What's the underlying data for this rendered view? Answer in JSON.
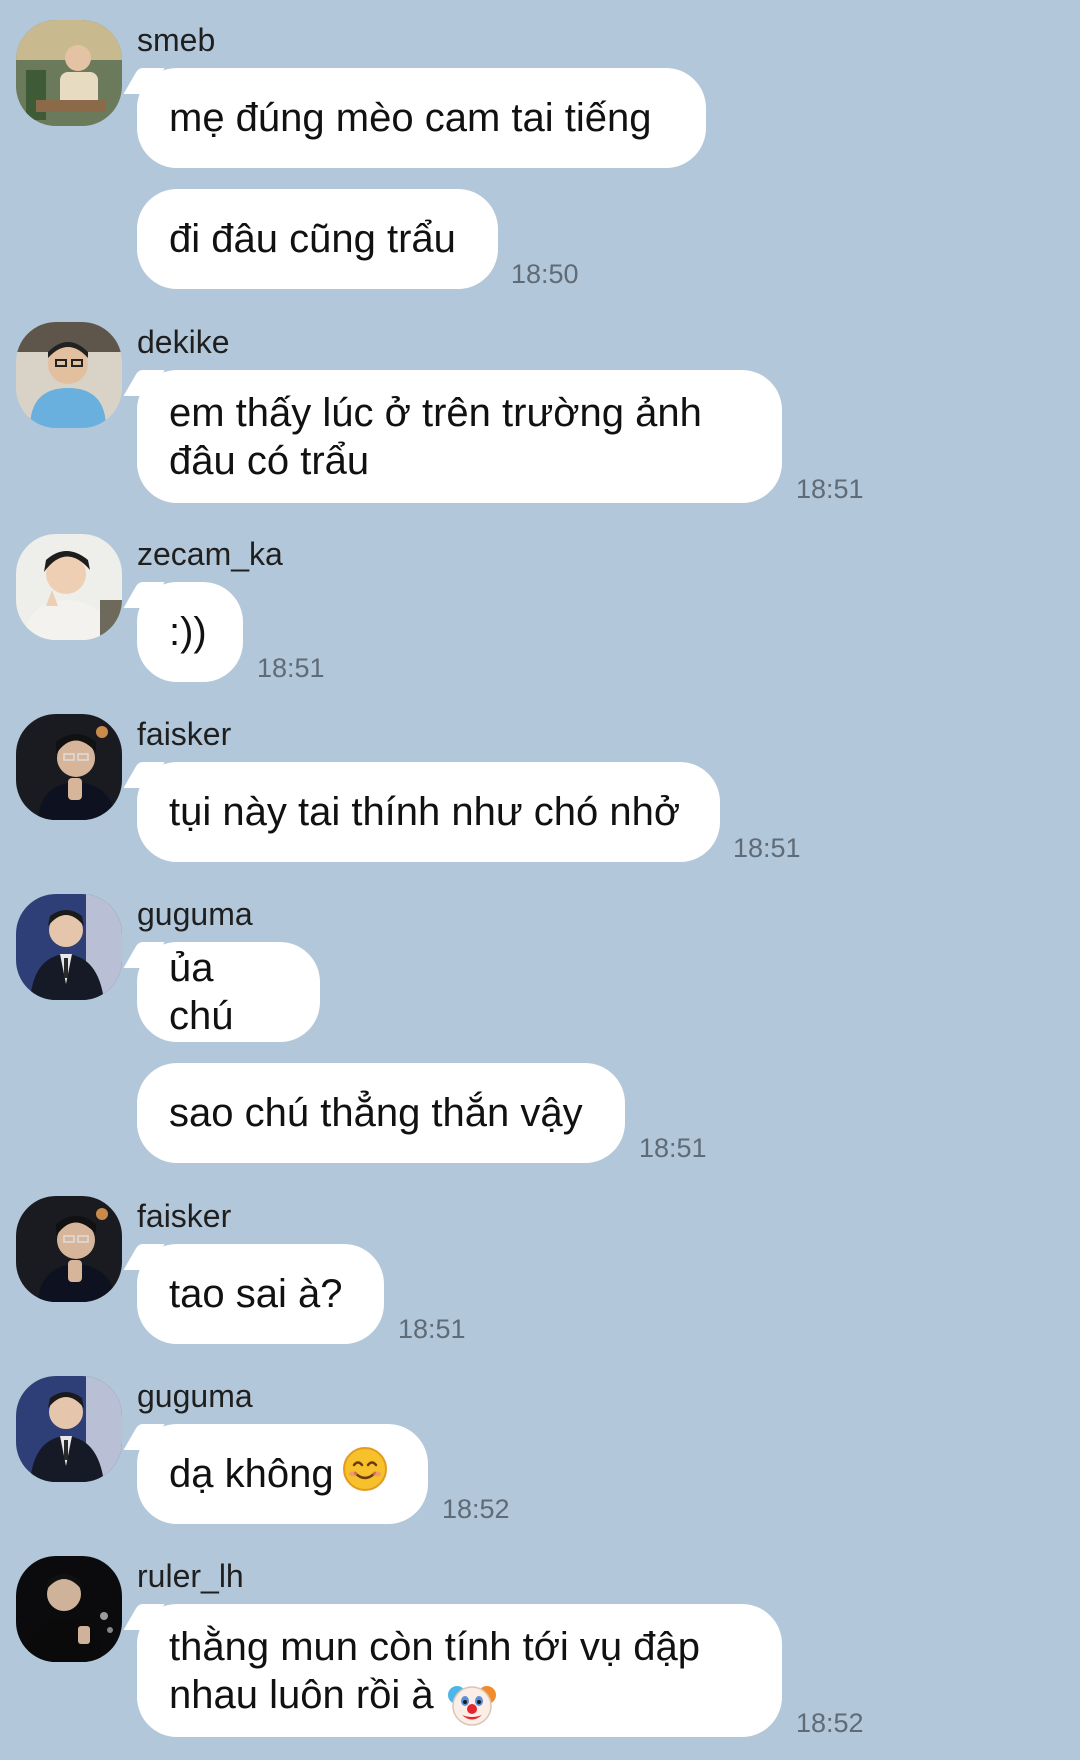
{
  "messages": [
    {
      "sender": "smeb",
      "avatar_icon": "avatar-smeb-icon",
      "bubbles": [
        "mẹ đúng mèo cam tai tiếng",
        "đi đâu cũng trẩu"
      ],
      "time": "18:50"
    },
    {
      "sender": "dekike",
      "avatar_icon": "avatar-dekike-icon",
      "bubbles": [
        "em thấy lúc ở trên trường ảnh\nđâu có trẩu"
      ],
      "time": "18:51"
    },
    {
      "sender": "zecam_ka",
      "avatar_icon": "avatar-zecam-icon",
      "bubbles": [
        ":))"
      ],
      "time": "18:51"
    },
    {
      "sender": "faisker",
      "avatar_icon": "avatar-faisker-icon",
      "bubbles": [
        "tụi này tai thính như chó nhở"
      ],
      "time": "18:51"
    },
    {
      "sender": "guguma",
      "avatar_icon": "avatar-guguma-icon",
      "bubbles": [
        "ủa chú",
        "sao chú thẳng thắn vậy"
      ],
      "time": "18:51"
    },
    {
      "sender": "faisker",
      "avatar_icon": "avatar-faisker-icon",
      "bubbles": [
        "tao sai à?"
      ],
      "time": "18:51"
    },
    {
      "sender": "guguma",
      "avatar_icon": "avatar-guguma-icon",
      "bubbles": [
        "dạ không"
      ],
      "bubble_emoji": "smiling-face-icon",
      "time": "18:52"
    },
    {
      "sender": "ruler_lh",
      "avatar_icon": "avatar-ruler-icon",
      "bubbles": [
        "thằng mun còn tính tới vụ đập\nnhau luôn rồi à"
      ],
      "bubble_emoji": "clown-face-icon",
      "time": "18:52"
    }
  ],
  "colors": {
    "background": "#b2c7d9",
    "bubble": "#ffffff",
    "time_text": "#5f6b77"
  }
}
